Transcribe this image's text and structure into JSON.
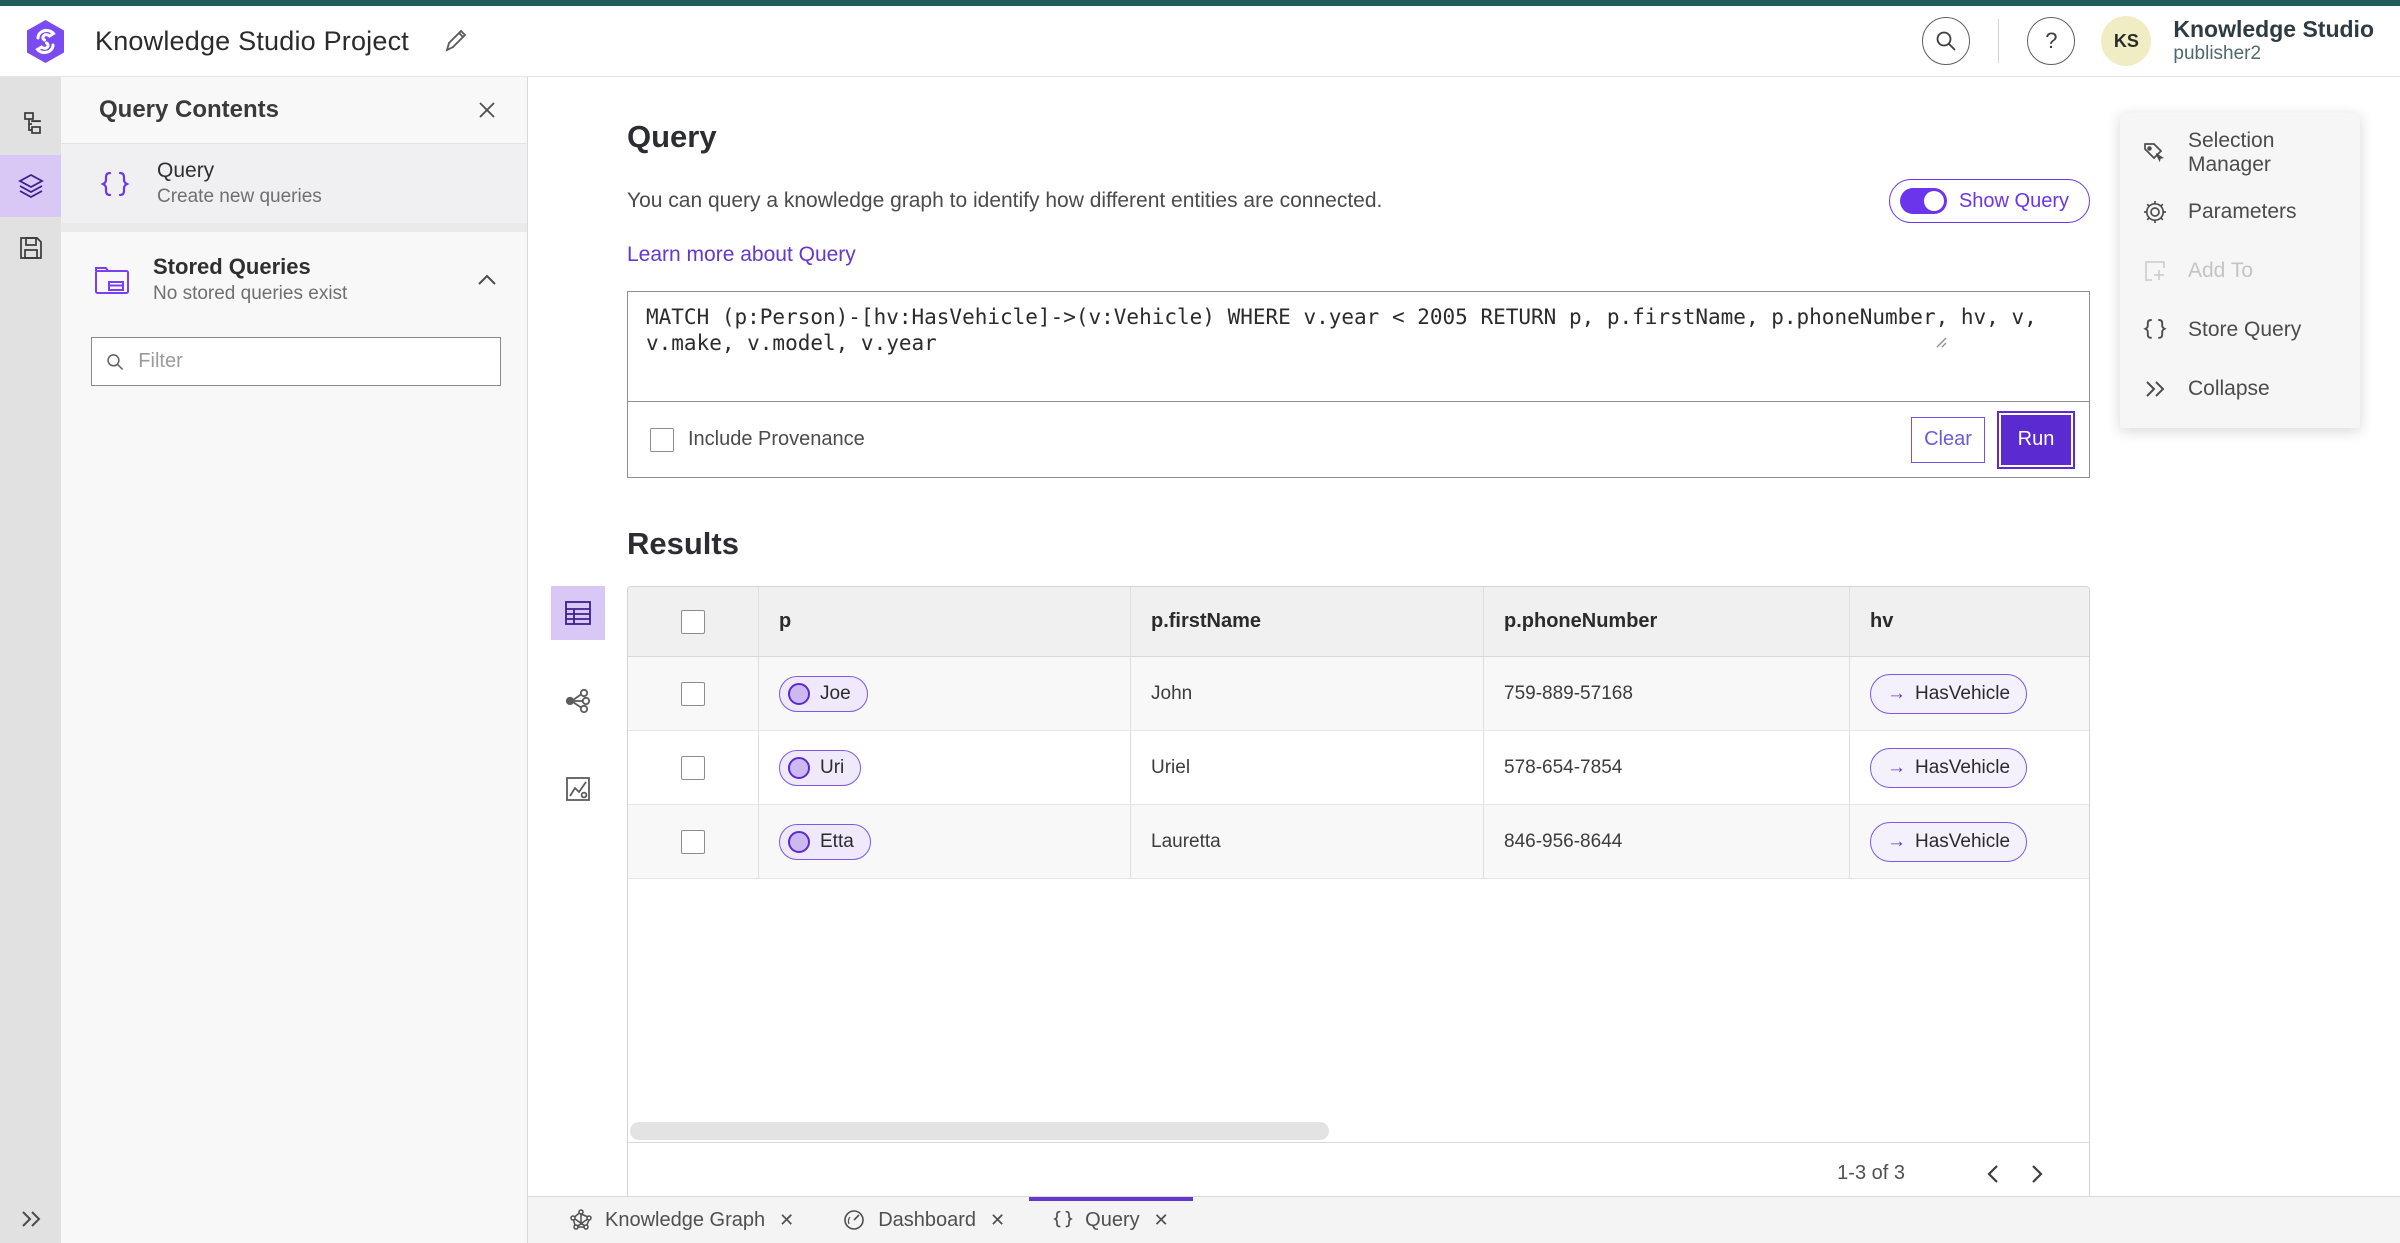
{
  "header": {
    "title": "Knowledge Studio Project",
    "product_name": "Knowledge Studio",
    "user_name": "publisher2",
    "avatar_initials": "KS",
    "help_glyph": "?"
  },
  "panel": {
    "title": "Query Contents",
    "query_item": {
      "title": "Query",
      "subtitle": "Create new queries"
    },
    "stored": {
      "title": "Stored Queries",
      "subtitle": "No stored queries exist"
    },
    "filter_placeholder": "Filter"
  },
  "query_section": {
    "title": "Query",
    "description": "You can query a knowledge graph to identify how different entities are connected.",
    "learn_more": "Learn more about Query",
    "show_query_label": "Show Query",
    "query_text": "MATCH (p:Person)-[hv:HasVehicle]->(v:Vehicle) WHERE v.year < 2005 RETURN p, p.firstName, p.phoneNumber, hv, v, v.make, v.model, v.year",
    "include_provenance_label": "Include Provenance",
    "clear_label": "Clear",
    "run_label": "Run"
  },
  "results": {
    "title": "Results",
    "columns": [
      "p",
      "p.firstName",
      "p.phoneNumber",
      "hv"
    ],
    "edge_arrow": "→",
    "rows": [
      {
        "p": "Joe",
        "firstName": "John",
        "phoneNumber": "759-889-57168",
        "hv": "HasVehicle"
      },
      {
        "p": "Uri",
        "firstName": "Uriel",
        "phoneNumber": "578-654-7854",
        "hv": "HasVehicle"
      },
      {
        "p": "Etta",
        "firstName": "Lauretta",
        "phoneNumber": "846-956-8644",
        "hv": "HasVehicle"
      }
    ],
    "pagination": "1-3 of 3"
  },
  "tools_panel": {
    "items": [
      "Selection Manager",
      "Parameters",
      "Add To",
      "Store Query",
      "Collapse"
    ]
  },
  "tabs": [
    {
      "label": "Knowledge Graph"
    },
    {
      "label": "Dashboard"
    },
    {
      "label": "Query"
    }
  ],
  "colors": {
    "accent_teal": "#1f5c5c",
    "primary_purple": "#5b2ad0",
    "toggle_purple": "#6a35ec",
    "link_purple": "#6437cf",
    "selected_light_purple": "#d9c8f6",
    "pill_border": "#7d57e8",
    "pill_bg": "#efe9fb",
    "avatar_bg": "#f0ecc3"
  }
}
